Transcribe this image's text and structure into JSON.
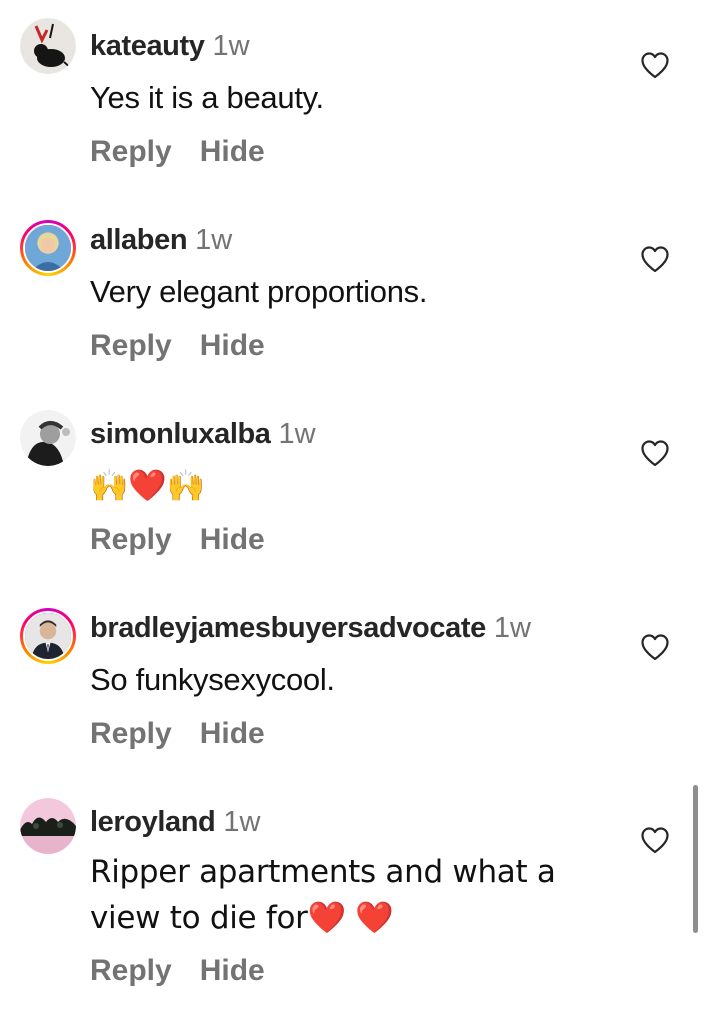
{
  "comments": [
    {
      "username": "kateauty",
      "time": "1w",
      "text": "Yes it is a beauty.",
      "reply_label": "Reply",
      "hide_label": "Hide",
      "avatar_icon": "rat-graffiti-avatar",
      "story_ring": false
    },
    {
      "username": "allaben",
      "time": "1w",
      "text": "Very elegant proportions.",
      "reply_label": "Reply",
      "hide_label": "Hide",
      "avatar_icon": "woman-portrait-avatar",
      "story_ring": true
    },
    {
      "username": "simonluxalba",
      "time": "1w",
      "text": "🙌❤️🙌",
      "reply_label": "Reply",
      "hide_label": "Hide",
      "avatar_icon": "bw-portrait-avatar",
      "story_ring": false
    },
    {
      "username": "bradleyjamesbuyersadvocate",
      "time": "1w",
      "text": "So funkysexycool.",
      "reply_label": "Reply",
      "hide_label": "Hide",
      "avatar_icon": "man-suit-avatar",
      "story_ring": true
    },
    {
      "username": "leroyland",
      "time": "1w",
      "text": "Ripper apartments and what a view to die for❤️ ❤️",
      "reply_label": "Reply",
      "hide_label": "Hide",
      "avatar_icon": "landscape-avatar",
      "story_ring": false
    }
  ],
  "icons": {
    "like": "heart-outline-icon"
  },
  "colors": {
    "username": "#262626",
    "secondary_text": "#737373",
    "story_ring_start": "#d300c5",
    "story_ring_end": "#ffd600"
  }
}
